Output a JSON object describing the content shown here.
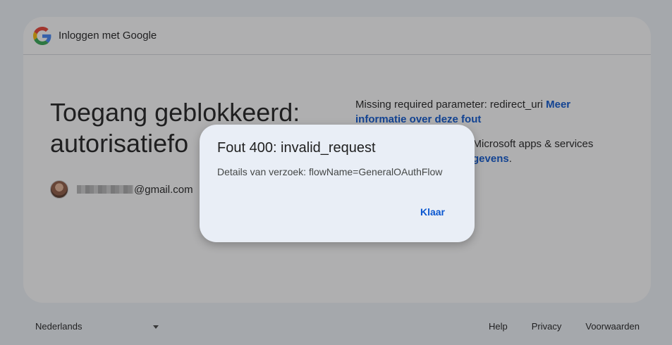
{
  "header": {
    "title": "Inloggen met Google",
    "logo_icon": "google-g-icon"
  },
  "main": {
    "title": "Toegang geblokkeerd: autorisatiefo",
    "account_email_suffix": "@gmail.com",
    "error_text": "Missing required parameter: redirect_uri ",
    "error_link": "Meer informatie over deze fout",
    "info_text": "n Microsoft apps & services",
    "info_link": "gevens",
    "info_tail": "."
  },
  "dialog": {
    "title": "Fout 400: invalid_request",
    "body": "Details van verzoek: flowName=GeneralOAuthFlow",
    "button": "Klaar"
  },
  "footer": {
    "language": "Nederlands",
    "links": [
      "Help",
      "Privacy",
      "Voorwaarden"
    ]
  },
  "colors": {
    "link": "#0b57d0",
    "background": "#f0f4f9",
    "dialog": "#e9eef6"
  }
}
